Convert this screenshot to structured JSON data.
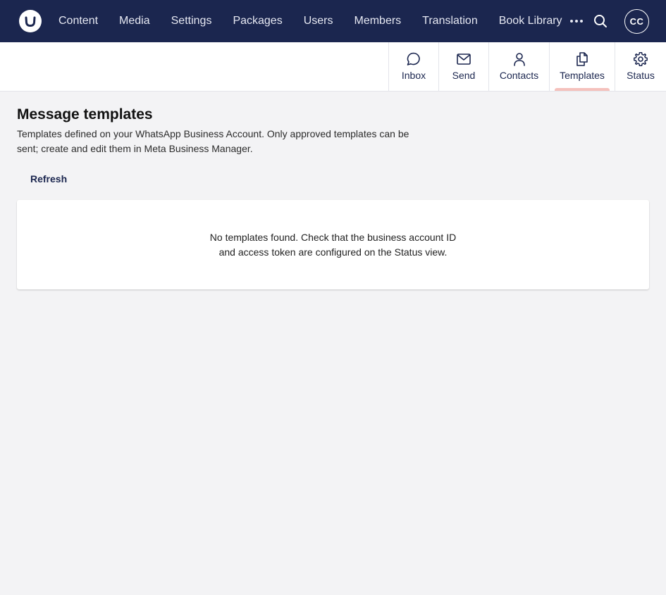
{
  "header": {
    "nav": [
      "Content",
      "Media",
      "Settings",
      "Packages",
      "Users",
      "Members",
      "Translation",
      "Book Library"
    ],
    "avatar_initials": "CC",
    "bg_color": "#1b264f"
  },
  "tabs": [
    {
      "label": "Inbox",
      "icon": "chat-bubble-icon",
      "active": false
    },
    {
      "label": "Send",
      "icon": "envelope-icon",
      "active": false
    },
    {
      "label": "Contacts",
      "icon": "person-icon",
      "active": false
    },
    {
      "label": "Templates",
      "icon": "documents-icon",
      "active": true
    },
    {
      "label": "Status",
      "icon": "gear-icon",
      "active": false
    }
  ],
  "main": {
    "title": "Message templates",
    "description": "Templates defined on your WhatsApp Business Account. Only approved templates can be sent; create and edit them in Meta Business Manager.",
    "refresh_label": "Refresh",
    "empty_message": "No templates found. Check that the business account ID and access token are configured on the Status view."
  }
}
